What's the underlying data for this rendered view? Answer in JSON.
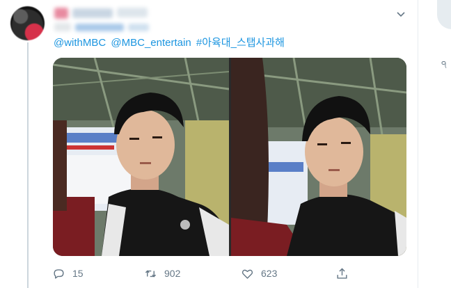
{
  "tweet": {
    "links": [
      "@withMBC",
      "@MBC_entertain",
      "#아육대_스탭사과해"
    ],
    "media_count": 2
  },
  "actions": {
    "reply_count": "15",
    "retweet_count": "902",
    "like_count": "623"
  },
  "icons": {
    "menu": "chevron-down-icon",
    "reply": "reply-icon",
    "retweet": "retweet-icon",
    "like": "heart-icon",
    "share": "share-icon"
  },
  "colors": {
    "link": "#1b95e0",
    "muted": "#657786",
    "border": "#e6ecf0"
  }
}
